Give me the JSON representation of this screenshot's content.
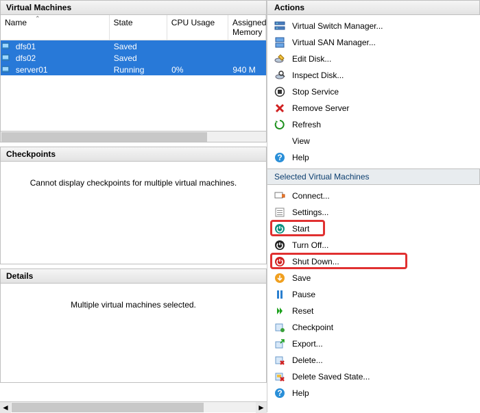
{
  "vm_panel": {
    "title": "Virtual Machines",
    "columns": {
      "name": "Name",
      "state": "State",
      "cpu": "CPU Usage",
      "assigned": "Assigned Memory"
    },
    "rows": [
      {
        "name": "dfs01",
        "state": "Saved",
        "cpu": "",
        "assigned": "",
        "selected": true
      },
      {
        "name": "dfs02",
        "state": "Saved",
        "cpu": "",
        "assigned": "",
        "selected": true
      },
      {
        "name": "server01",
        "state": "Running",
        "cpu": "0%",
        "assigned": "940 M",
        "selected": true
      }
    ]
  },
  "checkpoints": {
    "title": "Checkpoints",
    "message": "Cannot display checkpoints for multiple virtual machines."
  },
  "details": {
    "title": "Details",
    "message": "Multiple virtual machines selected."
  },
  "actions": {
    "title": "Actions",
    "host_items": [
      {
        "icon": "switch-manager-icon",
        "label": "Virtual Switch Manager..."
      },
      {
        "icon": "san-manager-icon",
        "label": "Virtual SAN Manager..."
      },
      {
        "icon": "edit-disk-icon",
        "label": "Edit Disk..."
      },
      {
        "icon": "inspect-disk-icon",
        "label": "Inspect Disk..."
      },
      {
        "icon": "stop-service-icon",
        "label": "Stop Service"
      },
      {
        "icon": "remove-server-icon",
        "label": "Remove Server"
      },
      {
        "icon": "refresh-icon",
        "label": "Refresh"
      },
      {
        "icon": "view-icon",
        "label": "View"
      },
      {
        "icon": "help-icon",
        "label": "Help"
      }
    ],
    "section_title": "Selected Virtual Machines",
    "vm_items": [
      {
        "icon": "connect-icon",
        "label": "Connect..."
      },
      {
        "icon": "settings-icon",
        "label": "Settings..."
      },
      {
        "icon": "start-icon",
        "label": "Start",
        "highlight": true
      },
      {
        "icon": "turnoff-icon",
        "label": "Turn Off..."
      },
      {
        "icon": "shutdown-icon",
        "label": "Shut Down...",
        "highlight": true
      },
      {
        "icon": "save-icon",
        "label": "Save"
      },
      {
        "icon": "pause-icon",
        "label": "Pause"
      },
      {
        "icon": "reset-icon",
        "label": "Reset"
      },
      {
        "icon": "checkpoint-icon",
        "label": "Checkpoint"
      },
      {
        "icon": "export-icon",
        "label": "Export..."
      },
      {
        "icon": "delete-icon",
        "label": "Delete..."
      },
      {
        "icon": "delete-saved-state-icon",
        "label": "Delete Saved State..."
      },
      {
        "icon": "help-icon",
        "label": "Help"
      }
    ]
  }
}
